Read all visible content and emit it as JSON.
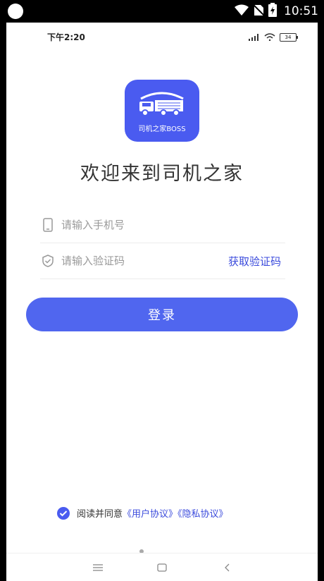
{
  "device_status": {
    "time": "10:51",
    "icons": [
      "wifi-icon",
      "no-sim-icon",
      "battery-charging-icon"
    ]
  },
  "inner_status": {
    "time": "下午2:20",
    "battery": "34",
    "icons": [
      "signal-icon",
      "wifi-icon",
      "battery-icon"
    ]
  },
  "logo": {
    "text": "司机之家BOSS",
    "icon": "truck-icon",
    "color": "#4a5bf0"
  },
  "welcome": "欢迎来到司机之家",
  "form": {
    "phone_placeholder": "请输入手机号",
    "code_placeholder": "请输入验证码",
    "get_code_label": "获取验证码",
    "login_label": "登录"
  },
  "agreement": {
    "prefix": "阅读并同意",
    "user_agreement": "《用户协议》",
    "privacy_policy": "《隐私协议》",
    "checked": true
  },
  "colors": {
    "accent": "#5066ef",
    "link": "#3b4bdc"
  }
}
